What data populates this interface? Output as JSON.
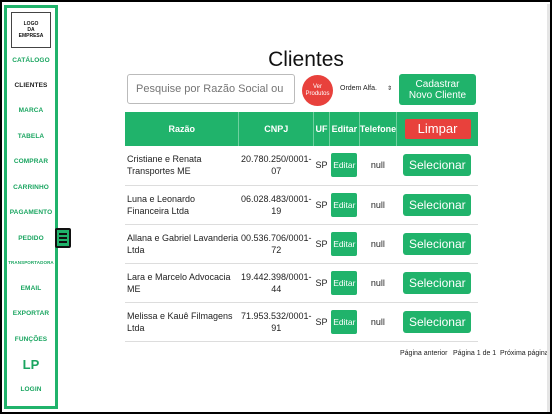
{
  "logo": {
    "line1": "LOGO",
    "line2": "DA",
    "line3": "EMPRESA"
  },
  "nav": {
    "catalogo": "CATÁLOGO",
    "clientes": "CLIENTES",
    "marca": "MARCA",
    "tabela": "TABELA",
    "comprar": "COMPRAR",
    "carrinho": "CARRINHO",
    "pagamento": "PAGAMENTO",
    "pedido": "PEDIDO",
    "transportadora": "TRANSPORTADORA",
    "email": "EMAIL",
    "exportar": "EXPORTAR",
    "funcoes": "FUNÇÕES",
    "lp": "LP",
    "login": "LOGIN"
  },
  "page_title": "Clientes",
  "search": {
    "placeholder": "Pesquise por Razão Social ou CNPJ"
  },
  "ver_produtos": {
    "line1": "Ver",
    "line2": "Produtos"
  },
  "order": {
    "selected": "Ordem Alfa."
  },
  "cadastrar": {
    "line1": "Cadastrar",
    "line2": "Novo Cliente"
  },
  "table": {
    "headers": {
      "razao": "Razão",
      "cnpj": "CNPJ",
      "uf": "UF",
      "editar": "Editar",
      "telefone": "Telefone"
    },
    "limpar": "Limpar",
    "edit_label": "Editar",
    "select_label": "Selecionar",
    "rows": [
      {
        "razao": "Cristiane e Renata Transportes ME",
        "cnpj": "20.780.250/0001-07",
        "uf": "SP",
        "telefone": "null"
      },
      {
        "razao": "Luna e Leonardo Financeira Ltda",
        "cnpj": "06.028.483/0001-19",
        "uf": "SP",
        "telefone": "null"
      },
      {
        "razao": "Allana e Gabriel Lavanderia Ltda",
        "cnpj": "00.536.706/0001-72",
        "uf": "SP",
        "telefone": "null"
      },
      {
        "razao": "Lara e Marcelo Advocacia ME",
        "cnpj": "19.442.398/0001-44",
        "uf": "SP",
        "telefone": "null"
      },
      {
        "razao": "Melissa e Kauê Filmagens Ltda",
        "cnpj": "71.953.532/0001-91",
        "uf": "SP",
        "telefone": "null"
      }
    ]
  },
  "pagination": {
    "prev": "Página anterior",
    "info": "Página 1 de 1",
    "next": "Próxima página"
  },
  "colors": {
    "accent": "#20b36b",
    "danger": "#e8413c"
  }
}
